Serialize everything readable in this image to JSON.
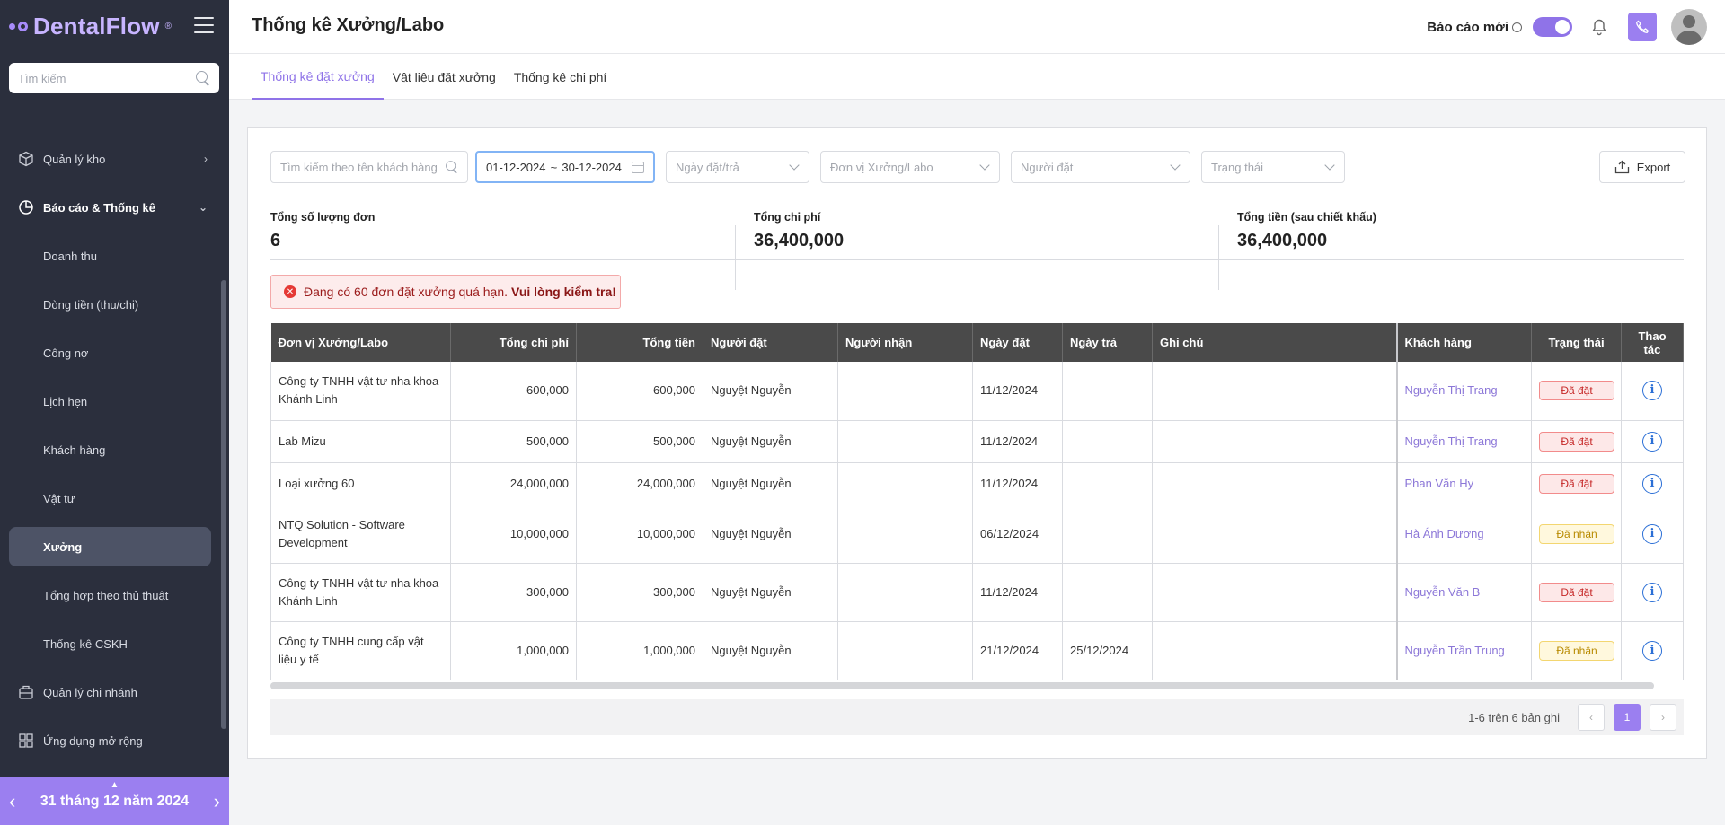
{
  "sidebar": {
    "logo": "DentalFlow",
    "logo_mark": "®",
    "search_placeholder": "Tìm kiếm",
    "items": [
      {
        "label": "Quản lý kho"
      },
      {
        "label": "Báo cáo & Thống kê"
      },
      {
        "label": "Doanh thu"
      },
      {
        "label": "Dòng tiền (thu/chi)"
      },
      {
        "label": "Công nợ"
      },
      {
        "label": "Lịch hẹn"
      },
      {
        "label": "Khách hàng"
      },
      {
        "label": "Vật tư"
      },
      {
        "label": "Xưởng"
      },
      {
        "label": "Tổng hợp theo thủ thuật"
      },
      {
        "label": "Thống kê CSKH"
      },
      {
        "label": "Quản lý chi nhánh"
      },
      {
        "label": "Ứng dụng mở rộng"
      }
    ],
    "date_label": "31 tháng 12 năm 2024"
  },
  "header": {
    "title": "Thống kê Xưởng/Labo",
    "new_report_label": "Báo cáo mới"
  },
  "tabs": [
    {
      "label": "Thống kê đặt xưởng"
    },
    {
      "label": "Vật liệu đặt xưởng"
    },
    {
      "label": "Thống kê chi phí"
    }
  ],
  "filters": {
    "search_placeholder": "Tìm kiếm theo tên khách hàng",
    "date_from": "01-12-2024",
    "date_sep": "~",
    "date_to": "30-12-2024",
    "date_type_placeholder": "Ngày đặt/trả",
    "lab_placeholder": "Đơn vị Xưởng/Labo",
    "orderer_placeholder": "Người đặt",
    "status_placeholder": "Trạng thái",
    "export_label": "Export"
  },
  "stats": {
    "orders_label": "Tổng số lượng đơn",
    "orders_value": "6",
    "cost_label": "Tổng chi phí",
    "cost_value": "36,400,000",
    "total_label": "Tổng tiền (sau chiết khấu)",
    "total_value": "36,400,000"
  },
  "alert": {
    "text": "Đang có 60 đơn đặt xưởng quá hạn.",
    "strong": "Vui lòng kiểm tra!"
  },
  "table": {
    "headers": [
      "Đơn vị Xưởng/Labo",
      "Tổng chi phí",
      "Tổng tiền",
      "Người đặt",
      "Người nhận",
      "Ngày đặt",
      "Ngày trả",
      "Ghi chú",
      "Khách hàng",
      "Trạng thái",
      "Thao tác"
    ],
    "rows": [
      {
        "lab": "Công ty TNHH vật tư nha khoa Khánh Linh",
        "cost": "600,000",
        "total": "600,000",
        "orderer": "Nguyệt Nguyễn",
        "receiver": "",
        "order_date": "11/12/2024",
        "return_date": "",
        "note": "",
        "customer": "Nguyễn Thị Trang",
        "status": "Đã đặt",
        "status_color": "red"
      },
      {
        "lab": "Lab Mizu",
        "cost": "500,000",
        "total": "500,000",
        "orderer": "Nguyệt Nguyễn",
        "receiver": "",
        "order_date": "11/12/2024",
        "return_date": "",
        "note": "",
        "customer": "Nguyễn Thị Trang",
        "status": "Đã đặt",
        "status_color": "red"
      },
      {
        "lab": "Loại xưởng 60",
        "cost": "24,000,000",
        "total": "24,000,000",
        "orderer": "Nguyệt Nguyễn",
        "receiver": "",
        "order_date": "11/12/2024",
        "return_date": "",
        "note": "",
        "customer": "Phan Văn Hy",
        "status": "Đã đặt",
        "status_color": "red"
      },
      {
        "lab": "NTQ Solution - Software Development",
        "cost": "10,000,000",
        "total": "10,000,000",
        "orderer": "Nguyệt Nguyễn",
        "receiver": "",
        "order_date": "06/12/2024",
        "return_date": "",
        "note": "",
        "customer": "Hà Ánh Dương",
        "status": "Đã nhận",
        "status_color": "yellow"
      },
      {
        "lab": "Công ty TNHH vật tư nha khoa Khánh Linh",
        "cost": "300,000",
        "total": "300,000",
        "orderer": "Nguyệt Nguyễn",
        "receiver": "",
        "order_date": "11/12/2024",
        "return_date": "",
        "note": "",
        "customer": "Nguyễn Văn B",
        "status": "Đã đặt",
        "status_color": "red"
      },
      {
        "lab": "Công ty TNHH cung cấp vật liệu y tế",
        "cost": "1,000,000",
        "total": "1,000,000",
        "orderer": "Nguyệt Nguyễn",
        "receiver": "",
        "order_date": "21/12/2024",
        "return_date": "25/12/2024",
        "note": "",
        "customer": "Nguyễn Trần Trung",
        "status": "Đã nhận",
        "status_color": "yellow"
      }
    ]
  },
  "pagination": {
    "info": "1-6 trên 6 bản ghi",
    "prev": "‹",
    "page": "1",
    "next": "›"
  },
  "colors": {
    "accent": "#9b7ff0",
    "sidebar_bg": "#2b2f3d",
    "table_header_bg": "#4a4a4a"
  },
  "icons": [
    "search-icon",
    "menu-icon",
    "box-icon",
    "chart-icon",
    "building-icon",
    "apps-icon",
    "bell-icon",
    "phone-icon",
    "calendar-icon",
    "export-icon",
    "info-icon",
    "error-icon"
  ]
}
